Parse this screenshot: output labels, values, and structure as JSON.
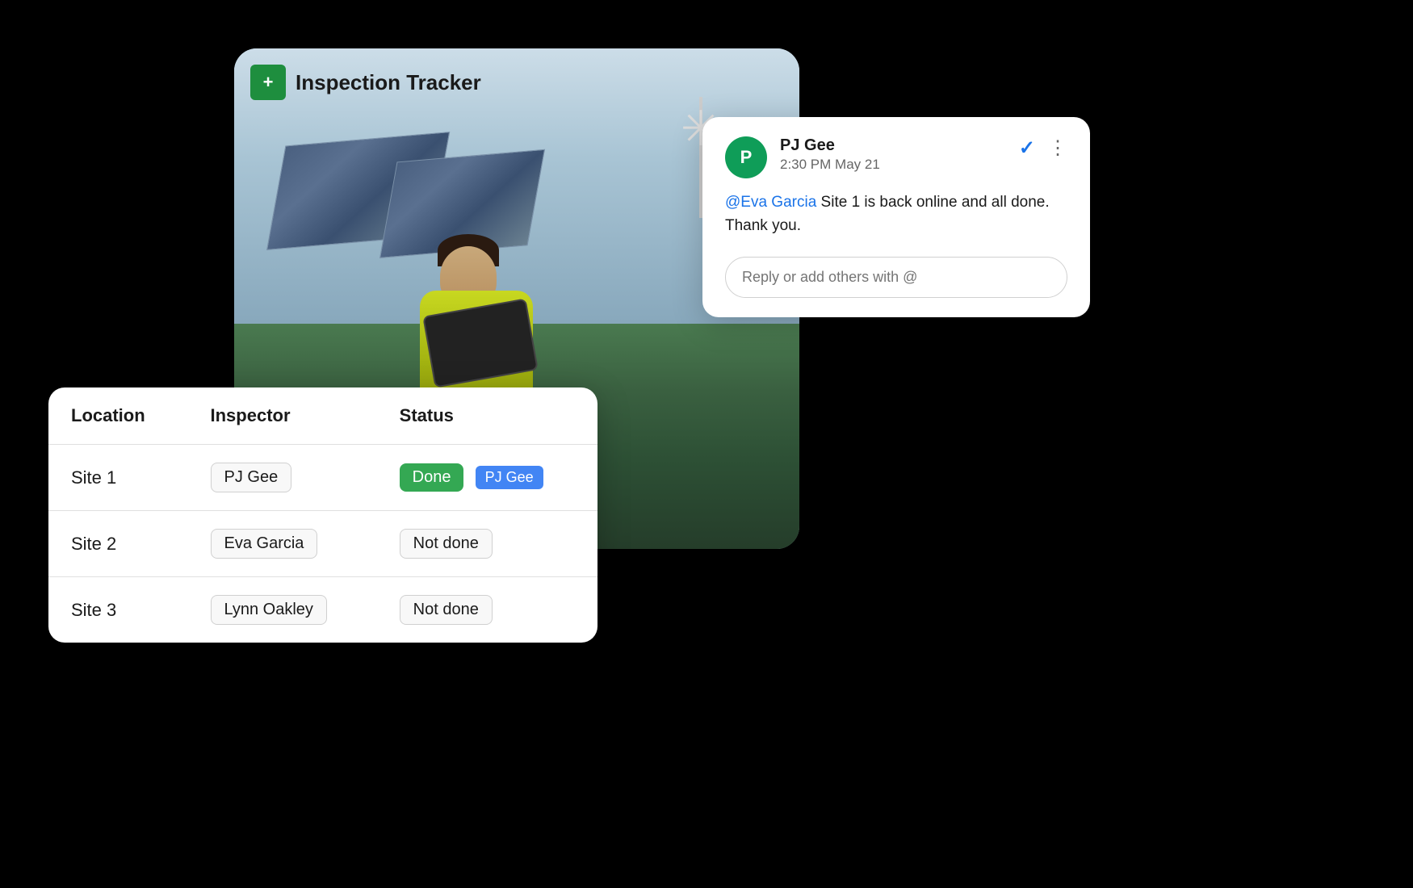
{
  "app": {
    "title": "Inspection Tracker",
    "icon_label": "+"
  },
  "table": {
    "headers": [
      "Location",
      "Inspector",
      "Status"
    ],
    "rows": [
      {
        "location": "Site 1",
        "inspector": "PJ Gee",
        "status": "Done",
        "status_type": "done",
        "tag": "PJ Gee"
      },
      {
        "location": "Site 2",
        "inspector": "Eva Garcia",
        "status": "Not done",
        "status_type": "not-done",
        "tag": null
      },
      {
        "location": "Site 3",
        "inspector": "Lynn Oakley",
        "status": "Not done",
        "status_type": "not-done",
        "tag": null
      }
    ]
  },
  "comment": {
    "avatar_initial": "P",
    "commenter": "PJ Gee",
    "timestamp": "2:30 PM May 21",
    "mention": "@Eva Garcia",
    "body": " Site 1 is back online and all done. Thank you.",
    "reply_placeholder": "Reply or add others with @"
  }
}
